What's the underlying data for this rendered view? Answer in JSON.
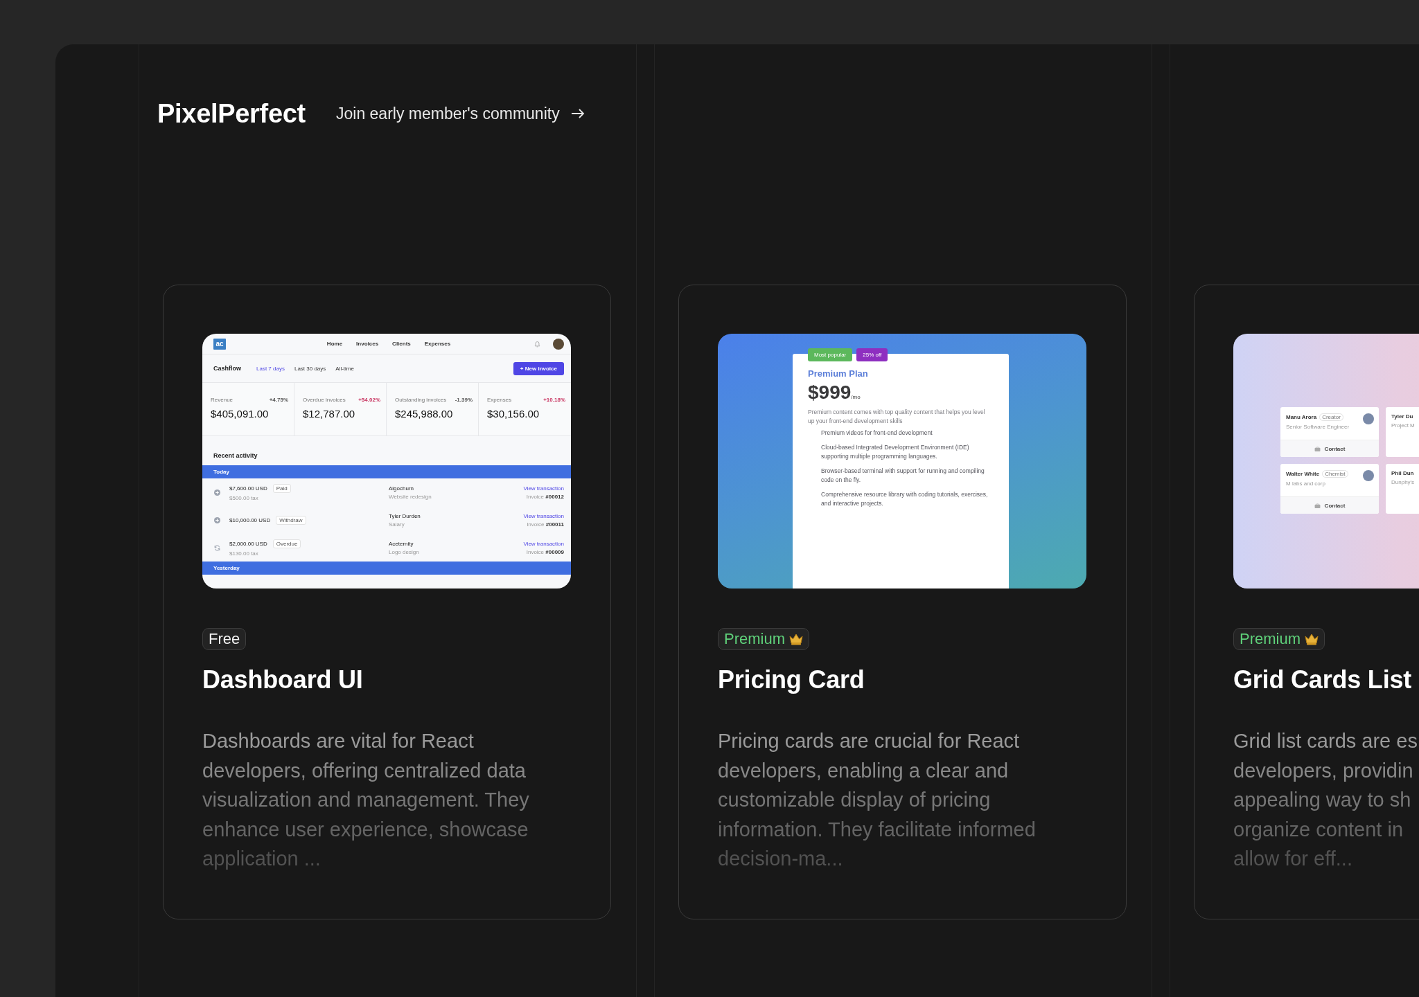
{
  "brand": "PixelPerfect",
  "community_link": {
    "label": "Join early member's community"
  },
  "cards": [
    {
      "kind": "dashboard",
      "badge": {
        "label": "Free",
        "kind": "free"
      },
      "title": "Dashboard UI",
      "description_lines": [
        "Dashboards are vital for React",
        "developers, offering centralized data",
        "visualization and management. They",
        "enhance user experience, showcase",
        "application ..."
      ],
      "preview": {
        "logo": "ac",
        "nav": [
          "Home",
          "Invoices",
          "Clients",
          "Expenses"
        ],
        "section": "Cashflow",
        "ranges": [
          {
            "label": "Last 7 days",
            "selected": true
          },
          {
            "label": "Last 30 days",
            "selected": false
          },
          {
            "label": "All-time",
            "selected": false
          }
        ],
        "button": "+ New invoice",
        "stats": [
          {
            "label": "Revenue",
            "change": "+4.75%",
            "color": "#555555",
            "value": "$405,091.00"
          },
          {
            "label": "Overdue invoices",
            "change": "+54.02%",
            "color": "#c8325f",
            "value": "$12,787.00"
          },
          {
            "label": "Outstanding invoices",
            "change": "-1.39%",
            "color": "#555555",
            "value": "$245,988.00"
          },
          {
            "label": "Expenses",
            "change": "+10.18%",
            "color": "#c8325f",
            "value": "$30,156.00"
          }
        ],
        "activity_title": "Recent activity",
        "groups": [
          {
            "label": "Today",
            "rows": [
              {
                "recurring": false,
                "amount": "$7,600.00 USD",
                "status": "Paid",
                "tax": "$500.00 tax",
                "client": "Algochurn",
                "project": "Website redesign",
                "link": "View transaction",
                "invoice_label": "Invoice",
                "invoice": "#00012"
              },
              {
                "recurring": false,
                "amount": "$10,000.00 USD",
                "status": "Withdraw",
                "client": "Tyler Durden",
                "project": "Salary",
                "link": "View transaction",
                "invoice_label": "Invoice",
                "invoice": "#00011"
              },
              {
                "recurring": true,
                "amount": "$2,000.00 USD",
                "status": "Overdue",
                "tax": "$130.00 tax",
                "client": "Aceternity",
                "project": "Logo design",
                "link": "View transaction",
                "invoice_label": "Invoice",
                "invoice": "#00009"
              }
            ]
          },
          {
            "label": "Yesterday"
          }
        ]
      }
    },
    {
      "kind": "pricing",
      "badge": {
        "label": "Premium",
        "kind": "premium"
      },
      "title": "Pricing Card",
      "description_lines": [
        "Pricing cards are crucial for React",
        "developers, enabling a clear and",
        "customizable display of pricing",
        "information. They facilitate informed",
        "decision-ma..."
      ],
      "preview": {
        "tags": [
          {
            "label": "Most popular",
            "color": "#5cb85c"
          },
          {
            "label": "25% off",
            "color": "#8e2fc0"
          }
        ],
        "plan": "Premium Plan",
        "price": "$999",
        "period": "/mo",
        "intro": "Premium content comes with top quality content that helps you level up your front-end development skills",
        "features": [
          "Premium videos for front-end development",
          "Cloud-based Integrated Development Environment (IDE) supporting multiple programming languages.",
          "Browser-based terminal with support for running and compiling code on the fly.",
          "Comprehensive resource library with coding tutorials, exercises, and interactive projects."
        ]
      }
    },
    {
      "kind": "grid",
      "badge": {
        "label": "Premium",
        "kind": "premium"
      },
      "title": "Grid Cards List",
      "description_lines": [
        "Grid list cards are es",
        "developers, providin",
        "appealing way to sh",
        "organize content in",
        "allow for eff..."
      ],
      "preview": {
        "people": [
          {
            "name": "Manu Arora",
            "tag": "Creator",
            "subtitle": "Senior Software Engineer",
            "action": "Contact"
          },
          {
            "name": "Tyler Du",
            "subtitle": "Project M"
          },
          {
            "name": "Walter White",
            "tag": "Chemist",
            "subtitle": "M labs and corp",
            "action": "Contact"
          },
          {
            "name": "Phil Dun",
            "subtitle": "Dunphy's"
          }
        ]
      }
    }
  ]
}
